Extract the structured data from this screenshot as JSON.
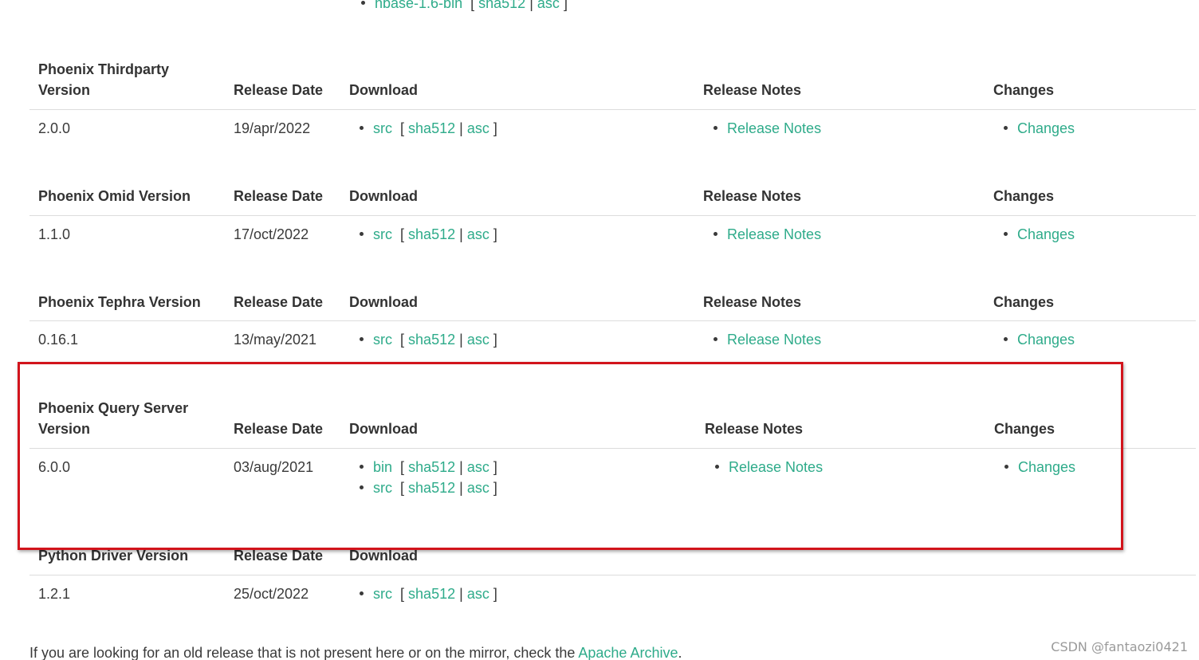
{
  "top_partial": {
    "label": "hbase-1.6-bin",
    "sha": "sha512",
    "sep": "|",
    "asc": "asc"
  },
  "tables": [
    {
      "headers": [
        "Phoenix Thirdparty",
        "Version",
        "Release Date",
        "Download",
        "Release Notes",
        "Changes"
      ],
      "version": "2.0.0",
      "date": "19/apr/2022",
      "downloads": [
        {
          "label": "src",
          "sha": "sha512",
          "asc": "asc"
        }
      ],
      "notes": "Release Notes",
      "changes": "Changes"
    },
    {
      "headers": [
        "Phoenix Omid Version",
        "Release Date",
        "Download",
        "Release Notes",
        "Changes"
      ],
      "version": "1.1.0",
      "date": "17/oct/2022",
      "downloads": [
        {
          "label": "src",
          "sha": "sha512",
          "asc": "asc"
        }
      ],
      "notes": "Release Notes",
      "changes": "Changes"
    },
    {
      "headers": [
        "Phoenix Tephra Version",
        "Release Date",
        "Download",
        "Release Notes",
        "Changes"
      ],
      "version": "0.16.1",
      "date": "13/may/2021",
      "downloads": [
        {
          "label": "src",
          "sha": "sha512",
          "asc": "asc"
        }
      ],
      "notes": "Release Notes",
      "changes": "Changes"
    },
    {
      "headers": [
        "Phoenix Query Server",
        "Version",
        "Release Date",
        "Download",
        "Release Notes",
        "Changes"
      ],
      "version": "6.0.0",
      "date": "03/aug/2021",
      "downloads": [
        {
          "label": "bin",
          "sha": "sha512",
          "asc": "asc"
        },
        {
          "label": "src",
          "sha": "sha512",
          "asc": "asc"
        }
      ],
      "notes": "Release Notes",
      "changes": "Changes"
    },
    {
      "headers": [
        "Python Driver Version",
        "Release Date",
        "Download"
      ],
      "version": "1.2.1",
      "date": "25/oct/2022",
      "downloads": [
        {
          "label": "src",
          "sha": "sha512",
          "asc": "asc"
        }
      ]
    }
  ],
  "bracket_open": "[",
  "bracket_close": "]",
  "pipe": "|",
  "footer": {
    "text": "If you are looking for an old release that is not present here or on the mirror, check the ",
    "link": "Apache Archive",
    "end": "."
  },
  "watermark": "CSDN @fantaozi0421",
  "colors": {
    "link": "#2eab8a",
    "highlight": "#d2141c",
    "text": "#3a3a3a"
  }
}
